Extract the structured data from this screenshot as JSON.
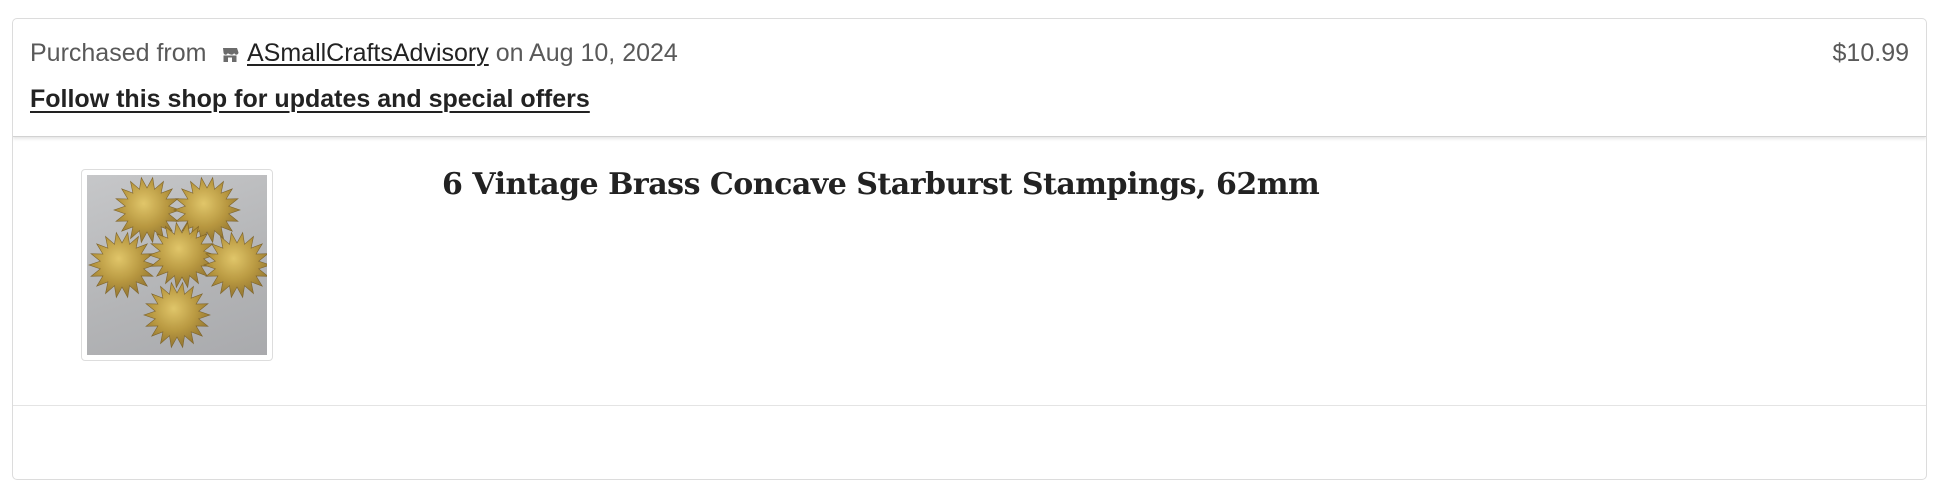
{
  "purchase": {
    "prefix": "Purchased from",
    "shop_icon": "shop-icon",
    "shop_name": "ASmallCraftsAdvisory",
    "date_text": "on Aug 10, 2024",
    "follow_text": "Follow this shop for updates and special offers",
    "price": "$10.99"
  },
  "item": {
    "title": "6 Vintage Brass Concave Starburst Stampings, 62mm",
    "image_icon": "brass-starburst-product-image"
  },
  "colors": {
    "text_primary": "#222222",
    "text_muted": "#595959",
    "border": "#dcdcdc",
    "brass": "#b8963a"
  }
}
